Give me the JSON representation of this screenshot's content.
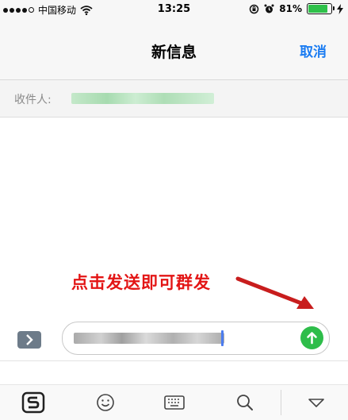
{
  "status_bar": {
    "carrier": "中国移动",
    "time": "13:25",
    "battery_percent": "81%",
    "battery_level": 0.81,
    "battery_color": "#2fc14a",
    "icons": [
      "signal-dots-icon",
      "wifi-icon",
      "rotation-lock-icon",
      "alarm-icon",
      "battery-icon",
      "charging-bolt-icon"
    ]
  },
  "nav": {
    "title": "新信息",
    "cancel_label": "取消",
    "accent_color": "#1b7cf2"
  },
  "recipient": {
    "label": "收件人:"
  },
  "annotation": {
    "text": "点击发送即可群发",
    "color": "#e31515"
  },
  "input_bar": {
    "icons": [
      "chevron-right-icon",
      "send-arrow-up-icon"
    ],
    "send_color": "#2ebd4a"
  },
  "keyboard_toolbar": {
    "icons": [
      "sogou-logo-icon",
      "emoji-icon",
      "keyboard-icon",
      "search-icon",
      "collapse-down-icon"
    ]
  }
}
